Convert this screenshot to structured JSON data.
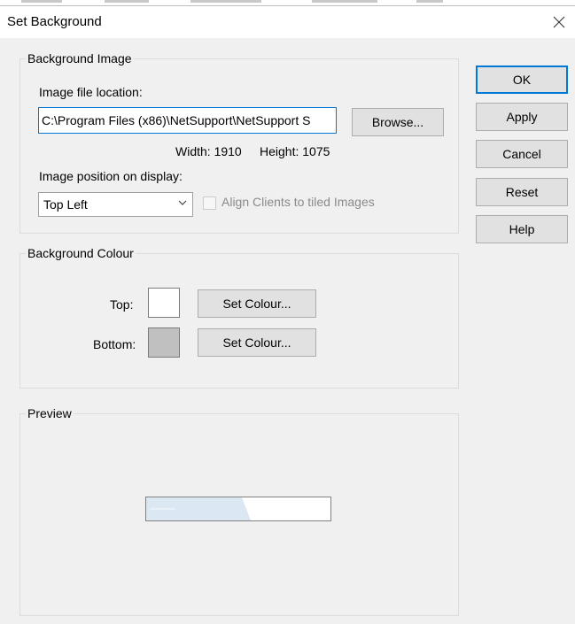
{
  "window": {
    "title": "Set Background"
  },
  "dialog_buttons": {
    "ok": "OK",
    "apply": "Apply",
    "cancel": "Cancel",
    "reset": "Reset",
    "help": "Help"
  },
  "background_image": {
    "group_title": "Background Image",
    "file_location_label": "Image file location:",
    "file_location_value": "C:\\Program Files (x86)\\NetSupport\\NetSupport S",
    "browse_label": "Browse...",
    "width_text": "Width: 1910",
    "height_text": "Height: 1075",
    "position_label": "Image position on display:",
    "position_value": "Top Left",
    "align_label": "Align Clients to tiled Images",
    "align_checked": false,
    "align_enabled": false
  },
  "background_colour": {
    "group_title": "Background Colour",
    "top_label": "Top:",
    "top_color": "#ffffff",
    "top_button": "Set Colour...",
    "bottom_label": "Bottom:",
    "bottom_color": "#c0c0c0",
    "bottom_button": "Set Colour..."
  },
  "preview": {
    "group_title": "Preview",
    "preview_image_color": "#dbe7f3"
  },
  "icons": {
    "close": "close-icon",
    "dropdown": "chevron-down-icon"
  },
  "colors": {
    "dialog_bg": "#f0f0f0",
    "focus_border": "#0078d7",
    "button_bg": "#e1e1e1"
  }
}
